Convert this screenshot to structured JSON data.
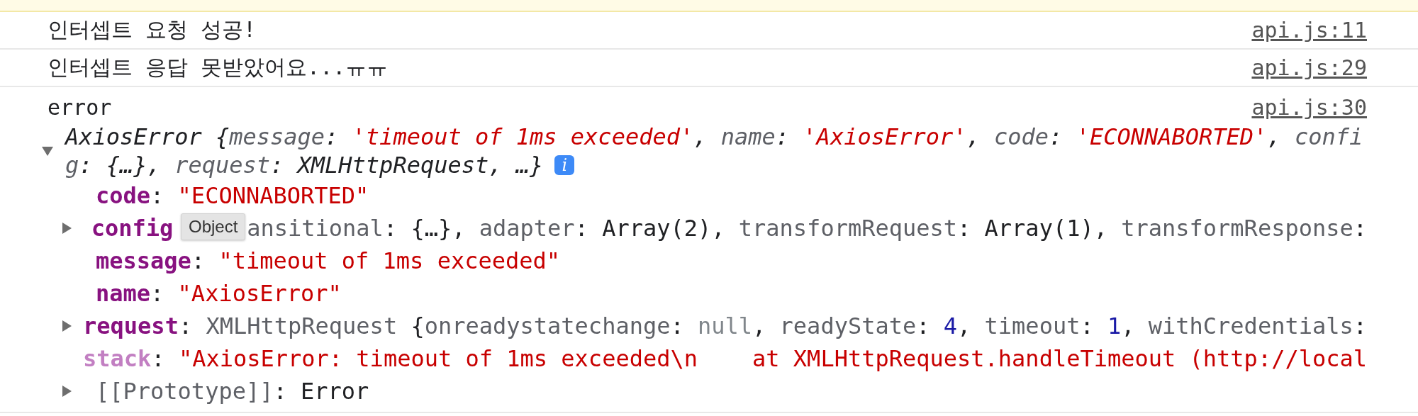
{
  "messages": [
    {
      "text": "인터셉트 요청 성공!",
      "source": "api.js:11"
    },
    {
      "text": "인터셉트 응답 못받았어요...ㅠㅠ",
      "source": "api.js:29"
    }
  ],
  "error_entry": {
    "label": "error",
    "source": "api.js:30",
    "expanded": true,
    "info_badge": "i",
    "preview_lines": [
      [
        {
          "kind": "plain",
          "text": "AxiosError {"
        },
        {
          "kind": "key",
          "text": "message"
        },
        {
          "kind": "plain",
          "text": ": "
        },
        {
          "kind": "string",
          "text": "'timeout of 1ms exceeded'"
        },
        {
          "kind": "plain",
          "text": ", "
        },
        {
          "kind": "key",
          "text": "name"
        },
        {
          "kind": "plain",
          "text": ": "
        },
        {
          "kind": "string",
          "text": "'AxiosError'"
        },
        {
          "kind": "plain",
          "text": ", "
        },
        {
          "kind": "key",
          "text": "code"
        },
        {
          "kind": "plain",
          "text": ": "
        },
        {
          "kind": "string",
          "text": "'ECONNABORTED'"
        },
        {
          "kind": "plain",
          "text": ", "
        },
        {
          "kind": "key",
          "text": "confi"
        }
      ],
      [
        {
          "kind": "key",
          "text": "g"
        },
        {
          "kind": "plain",
          "text": ": {…}, "
        },
        {
          "kind": "key",
          "text": "request"
        },
        {
          "kind": "plain",
          "text": ": XMLHttpRequest, …}"
        }
      ]
    ],
    "properties": [
      {
        "segments": [
          {
            "kind": "own_key",
            "text": "code"
          },
          {
            "kind": "plain",
            "text": ": "
          },
          {
            "kind": "string",
            "text": "\"ECONNABORTED\""
          }
        ]
      },
      {
        "expanded": false,
        "segments": [
          {
            "kind": "own_key",
            "text": "config"
          }
        ],
        "tooltip": "Object",
        "rest": [
          {
            "kind": "key",
            "text": "ansitional"
          },
          {
            "kind": "plain",
            "text": ": {…}, "
          },
          {
            "kind": "key",
            "text": "adapter"
          },
          {
            "kind": "plain",
            "text": ": Array(2), "
          },
          {
            "kind": "key",
            "text": "transformRequest"
          },
          {
            "kind": "plain",
            "text": ": Array(1), "
          },
          {
            "kind": "key",
            "text": "transformResponse"
          },
          {
            "kind": "plain",
            "text": ":"
          }
        ]
      },
      {
        "segments": [
          {
            "kind": "own_key",
            "text": "message"
          },
          {
            "kind": "plain",
            "text": ": "
          },
          {
            "kind": "string",
            "text": "\"timeout of 1ms exceeded\""
          }
        ]
      },
      {
        "segments": [
          {
            "kind": "own_key",
            "text": "name"
          },
          {
            "kind": "plain",
            "text": ": "
          },
          {
            "kind": "string",
            "text": "\"AxiosError\""
          }
        ]
      },
      {
        "expanded": false,
        "segments": [
          {
            "kind": "own_key",
            "text": "request"
          },
          {
            "kind": "plain",
            "text": ": "
          },
          {
            "kind": "type",
            "text": "XMLHttpRequest"
          },
          {
            "kind": "plain",
            "text": " {"
          },
          {
            "kind": "key",
            "text": "onreadystatechange"
          },
          {
            "kind": "plain",
            "text": ": "
          },
          {
            "kind": "null",
            "text": "null"
          },
          {
            "kind": "plain",
            "text": ", "
          },
          {
            "kind": "key",
            "text": "readyState"
          },
          {
            "kind": "plain",
            "text": ": "
          },
          {
            "kind": "number",
            "text": "4"
          },
          {
            "kind": "plain",
            "text": ", "
          },
          {
            "kind": "key",
            "text": "timeout"
          },
          {
            "kind": "plain",
            "text": ": "
          },
          {
            "kind": "number",
            "text": "1"
          },
          {
            "kind": "plain",
            "text": ", "
          },
          {
            "kind": "key",
            "text": "withCredentials"
          },
          {
            "kind": "plain",
            "text": ":"
          }
        ]
      },
      {
        "segments": [
          {
            "kind": "hidden_key",
            "text": "stack"
          },
          {
            "kind": "plain",
            "text": ": "
          },
          {
            "kind": "string",
            "text": "\"AxiosError: timeout of 1ms exceeded\\n    at XMLHttpRequest.handleTimeout (http://local"
          }
        ]
      },
      {
        "expanded": false,
        "segments": [
          {
            "kind": "internal_key",
            "text": "[[Prototype]]"
          },
          {
            "kind": "plain",
            "text": ": "
          },
          {
            "kind": "plain",
            "text": "Error"
          }
        ]
      }
    ]
  }
}
